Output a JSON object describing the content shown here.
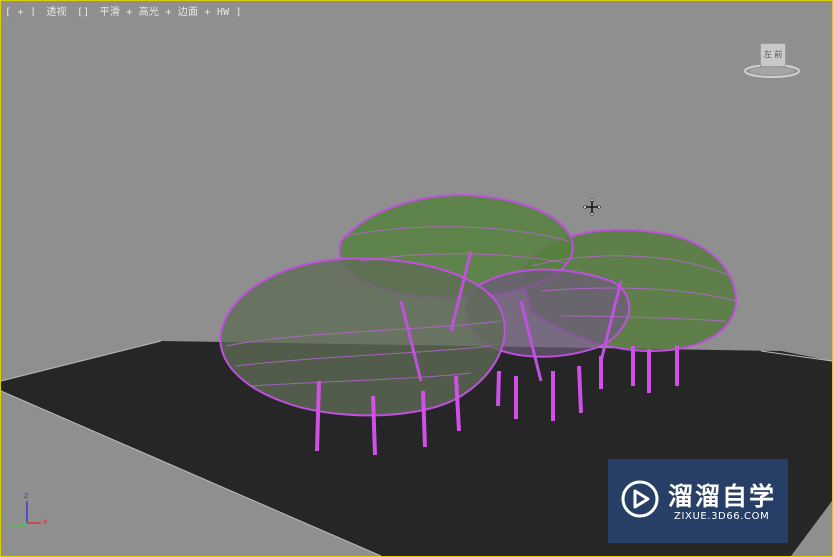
{
  "viewport": {
    "label_parts": [
      "[ + ]",
      "透视",
      "[]",
      "平滑 + 高光 + 边面 + HW ]"
    ],
    "border_color": "#d8d000",
    "background_color": "#8f8f8f",
    "ground_color": "#262626",
    "wire_color": "#c050e0",
    "foliage_color": "#4a7a2a"
  },
  "viewcube": {
    "face_label": "左 前",
    "icon": "viewcube-icon"
  },
  "axes": {
    "z": "z",
    "y": "y",
    "x": "x"
  },
  "watermark": {
    "brand": "溜溜自学",
    "url": "ZIXUE.3D66.COM",
    "icon": "play-logo-icon"
  },
  "cursor": {
    "icon": "move-cursor-icon"
  }
}
